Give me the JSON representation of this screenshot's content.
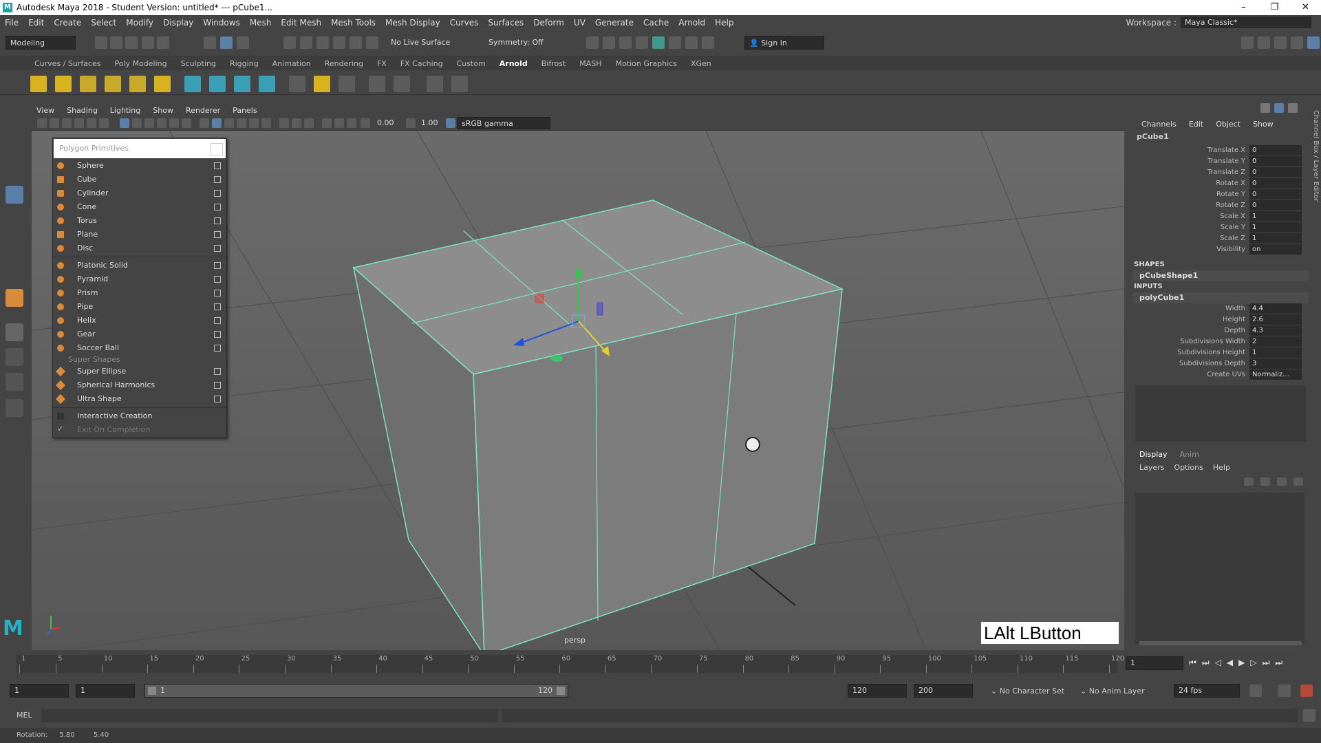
{
  "window": {
    "title": "Autodesk Maya 2018 - Student Version: untitled*   ---   pCube1...",
    "min": "–",
    "max": "❐",
    "close": "✕"
  },
  "menubar": {
    "items": [
      "File",
      "Edit",
      "Create",
      "Select",
      "Modify",
      "Display",
      "Windows",
      "Mesh",
      "Edit Mesh",
      "Mesh Tools",
      "Mesh Display",
      "Curves",
      "Surfaces",
      "Deform",
      "UV",
      "Generate",
      "Cache",
      "Arnold",
      "Help"
    ],
    "workspace_label": "Workspace :",
    "workspace_value": "Maya Classic*"
  },
  "statusline": {
    "mode": "Modeling",
    "live_surface": "No Live Surface",
    "symmetry": "Symmetry: Off",
    "sign_in": "Sign In"
  },
  "shelf_tabs": [
    "Curves / Surfaces",
    "Poly Modeling",
    "Sculpting",
    "Rigging",
    "Animation",
    "Rendering",
    "FX",
    "FX Caching",
    "Custom",
    "Arnold",
    "Bifrost",
    "MASH",
    "Motion Graphics",
    "XGen"
  ],
  "shelf_active": "Arnold",
  "panel": {
    "menus": [
      "View",
      "Shading",
      "Lighting",
      "Show",
      "Renderer",
      "Panels"
    ],
    "exposure": "0.00",
    "gamma": "1.00",
    "colorspace": "sRGB gamma",
    "camera": "persp",
    "hotkey_display": "LAlt LButton"
  },
  "poly_menu": {
    "title": "Polygon Primitives",
    "items_a": [
      "Sphere",
      "Cube",
      "Cylinder",
      "Cone",
      "Torus",
      "Plane",
      "Disc"
    ],
    "items_b": [
      "Platonic Solid",
      "Pyramid",
      "Prism",
      "Pipe",
      "Helix",
      "Gear",
      "Soccer Ball"
    ],
    "super_label": "Super Shapes",
    "items_c": [
      "Super Ellipse",
      "Spherical Harmonics",
      "Ultra Shape"
    ],
    "interactive": "Interactive Creation",
    "exit_on": "Exit On Completion"
  },
  "channel_box": {
    "menus": [
      "Channels",
      "Edit",
      "Object",
      "Show"
    ],
    "object": "pCube1",
    "attrs": [
      {
        "label": "Translate X",
        "value": "0"
      },
      {
        "label": "Translate Y",
        "value": "0"
      },
      {
        "label": "Translate Z",
        "value": "0"
      },
      {
        "label": "Rotate X",
        "value": "0"
      },
      {
        "label": "Rotate Y",
        "value": "0"
      },
      {
        "label": "Rotate Z",
        "value": "0"
      },
      {
        "label": "Scale X",
        "value": "1"
      },
      {
        "label": "Scale Y",
        "value": "1"
      },
      {
        "label": "Scale Z",
        "value": "1"
      },
      {
        "label": "Visibility",
        "value": "on"
      }
    ],
    "shapes_label": "SHAPES",
    "shape_name": "pCubeShape1",
    "inputs_label": "INPUTS",
    "input_name": "polyCube1",
    "input_attrs": [
      {
        "label": "Width",
        "value": "4.4"
      },
      {
        "label": "Height",
        "value": "2.6"
      },
      {
        "label": "Depth",
        "value": "4.3"
      },
      {
        "label": "Subdivisions Width",
        "value": "2"
      },
      {
        "label": "Subdivisions Height",
        "value": "1"
      },
      {
        "label": "Subdivisions Depth",
        "value": "3"
      },
      {
        "label": "Create UVs",
        "value": "Normaliz..."
      }
    ],
    "side_label": "Channel Box / Layer Editor"
  },
  "layer_editor": {
    "tabs": [
      "Display",
      "Anim"
    ],
    "menus": [
      "Layers",
      "Options",
      "Help"
    ]
  },
  "timeline": {
    "ticks": [
      "5",
      "10",
      "15",
      "20",
      "25",
      "30",
      "35",
      "40",
      "45",
      "50",
      "55",
      "60",
      "65",
      "70",
      "75",
      "80",
      "85",
      "90",
      "95",
      "100",
      "105",
      "110",
      "115",
      "120"
    ],
    "start_tick": "1",
    "current_frame": "1"
  },
  "range": {
    "start": "1",
    "playback_start": "1",
    "slider_start": "1",
    "slider_end": "120",
    "playback_end": "120",
    "end": "200",
    "character_set": "No Character Set",
    "anim_layer": "No Anim Layer",
    "fps": "24 fps"
  },
  "cmdline": {
    "lang": "MEL"
  },
  "helpline": {
    "label": "Rotation:",
    "v1": "5.80",
    "v2": "5.40"
  }
}
